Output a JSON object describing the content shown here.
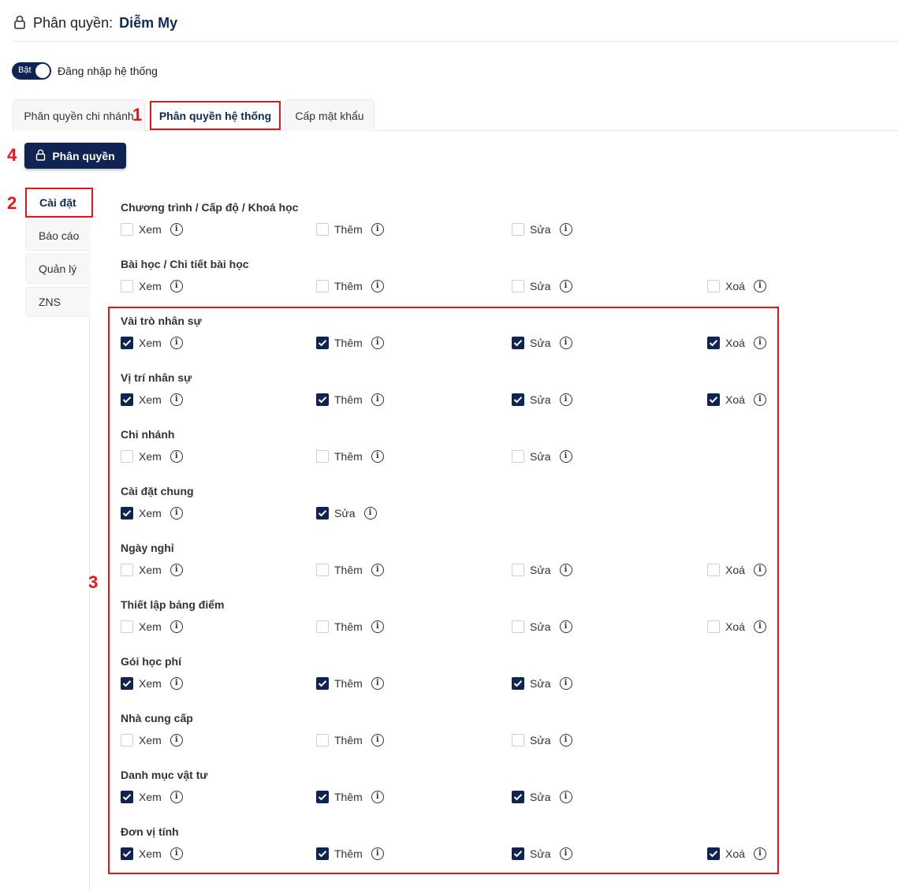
{
  "header": {
    "lock_icon": "lock-icon",
    "title": "Phân quyền:",
    "name": "Diễm My"
  },
  "login_toggle": {
    "state_label": "Bật",
    "on": true,
    "label": "Đăng nhập hệ thống"
  },
  "tabs": [
    {
      "label": "Phân quyền chi nhánh",
      "active": false
    },
    {
      "label": "Phân quyền hệ thống",
      "active": true
    },
    {
      "label": "Cấp mật khẩu",
      "active": false
    }
  ],
  "action_button": {
    "icon": "lock-icon",
    "label": "Phân quyền"
  },
  "sidebar": {
    "items": [
      {
        "label": "Cài đặt",
        "active": true
      },
      {
        "label": "Báo cáo",
        "active": false
      },
      {
        "label": "Quản lý",
        "active": false
      },
      {
        "label": "ZNS",
        "active": false
      }
    ]
  },
  "annotations": {
    "m1": "1",
    "m2": "2",
    "m3": "3",
    "m4": "4"
  },
  "groups": [
    {
      "title": "Chương trình / Cấp độ / Khoá học",
      "perms": [
        {
          "label": "Xem",
          "checked": false,
          "col": 0
        },
        {
          "label": "Thêm",
          "checked": false,
          "col": 1
        },
        {
          "label": "Sửa",
          "checked": false,
          "col": 2
        }
      ]
    },
    {
      "title": "Bài học / Chi tiết bài học",
      "perms": [
        {
          "label": "Xem",
          "checked": false,
          "col": 0
        },
        {
          "label": "Thêm",
          "checked": false,
          "col": 1
        },
        {
          "label": "Sửa",
          "checked": false,
          "col": 2
        },
        {
          "label": "Xoá",
          "checked": false,
          "col": 3
        }
      ]
    },
    {
      "title": "Vài trò nhân sự",
      "perms": [
        {
          "label": "Xem",
          "checked": true,
          "col": 0
        },
        {
          "label": "Thêm",
          "checked": true,
          "col": 1
        },
        {
          "label": "Sửa",
          "checked": true,
          "col": 2
        },
        {
          "label": "Xoá",
          "checked": true,
          "col": 3
        }
      ]
    },
    {
      "title": "Vị trí nhân sự",
      "perms": [
        {
          "label": "Xem",
          "checked": true,
          "col": 0
        },
        {
          "label": "Thêm",
          "checked": true,
          "col": 1
        },
        {
          "label": "Sửa",
          "checked": true,
          "col": 2
        },
        {
          "label": "Xoá",
          "checked": true,
          "col": 3
        }
      ]
    },
    {
      "title": "Chi nhánh",
      "perms": [
        {
          "label": "Xem",
          "checked": false,
          "col": 0
        },
        {
          "label": "Thêm",
          "checked": false,
          "col": 1
        },
        {
          "label": "Sửa",
          "checked": false,
          "col": 2
        }
      ]
    },
    {
      "title": "Cài đặt chung",
      "perms": [
        {
          "label": "Xem",
          "checked": true,
          "col": 0
        },
        {
          "label": "Sửa",
          "checked": true,
          "col": 1
        }
      ]
    },
    {
      "title": "Ngày nghỉ",
      "perms": [
        {
          "label": "Xem",
          "checked": false,
          "col": 0
        },
        {
          "label": "Thêm",
          "checked": false,
          "col": 1
        },
        {
          "label": "Sửa",
          "checked": false,
          "col": 2
        },
        {
          "label": "Xoá",
          "checked": false,
          "col": 3
        }
      ]
    },
    {
      "title": "Thiết lập bảng điểm",
      "perms": [
        {
          "label": "Xem",
          "checked": false,
          "col": 0
        },
        {
          "label": "Thêm",
          "checked": false,
          "col": 1
        },
        {
          "label": "Sửa",
          "checked": false,
          "col": 2
        },
        {
          "label": "Xoá",
          "checked": false,
          "col": 3
        }
      ]
    },
    {
      "title": "Gói học phí",
      "perms": [
        {
          "label": "Xem",
          "checked": true,
          "col": 0
        },
        {
          "label": "Thêm",
          "checked": true,
          "col": 1
        },
        {
          "label": "Sửa",
          "checked": true,
          "col": 2
        }
      ]
    },
    {
      "title": "Nhà cung cấp",
      "perms": [
        {
          "label": "Xem",
          "checked": false,
          "col": 0
        },
        {
          "label": "Thêm",
          "checked": false,
          "col": 1
        },
        {
          "label": "Sửa",
          "checked": false,
          "col": 2
        }
      ]
    },
    {
      "title": "Danh mục vật tư",
      "perms": [
        {
          "label": "Xem",
          "checked": true,
          "col": 0
        },
        {
          "label": "Thêm",
          "checked": true,
          "col": 1
        },
        {
          "label": "Sửa",
          "checked": true,
          "col": 2
        }
      ]
    },
    {
      "title": "Đơn vị tính",
      "perms": [
        {
          "label": "Xem",
          "checked": true,
          "col": 0
        },
        {
          "label": "Thêm",
          "checked": true,
          "col": 1
        },
        {
          "label": "Sửa",
          "checked": true,
          "col": 2
        },
        {
          "label": "Xoá",
          "checked": true,
          "col": 3
        }
      ]
    }
  ],
  "colors": {
    "primary": "#0f2452",
    "highlight": "#e8141c"
  }
}
